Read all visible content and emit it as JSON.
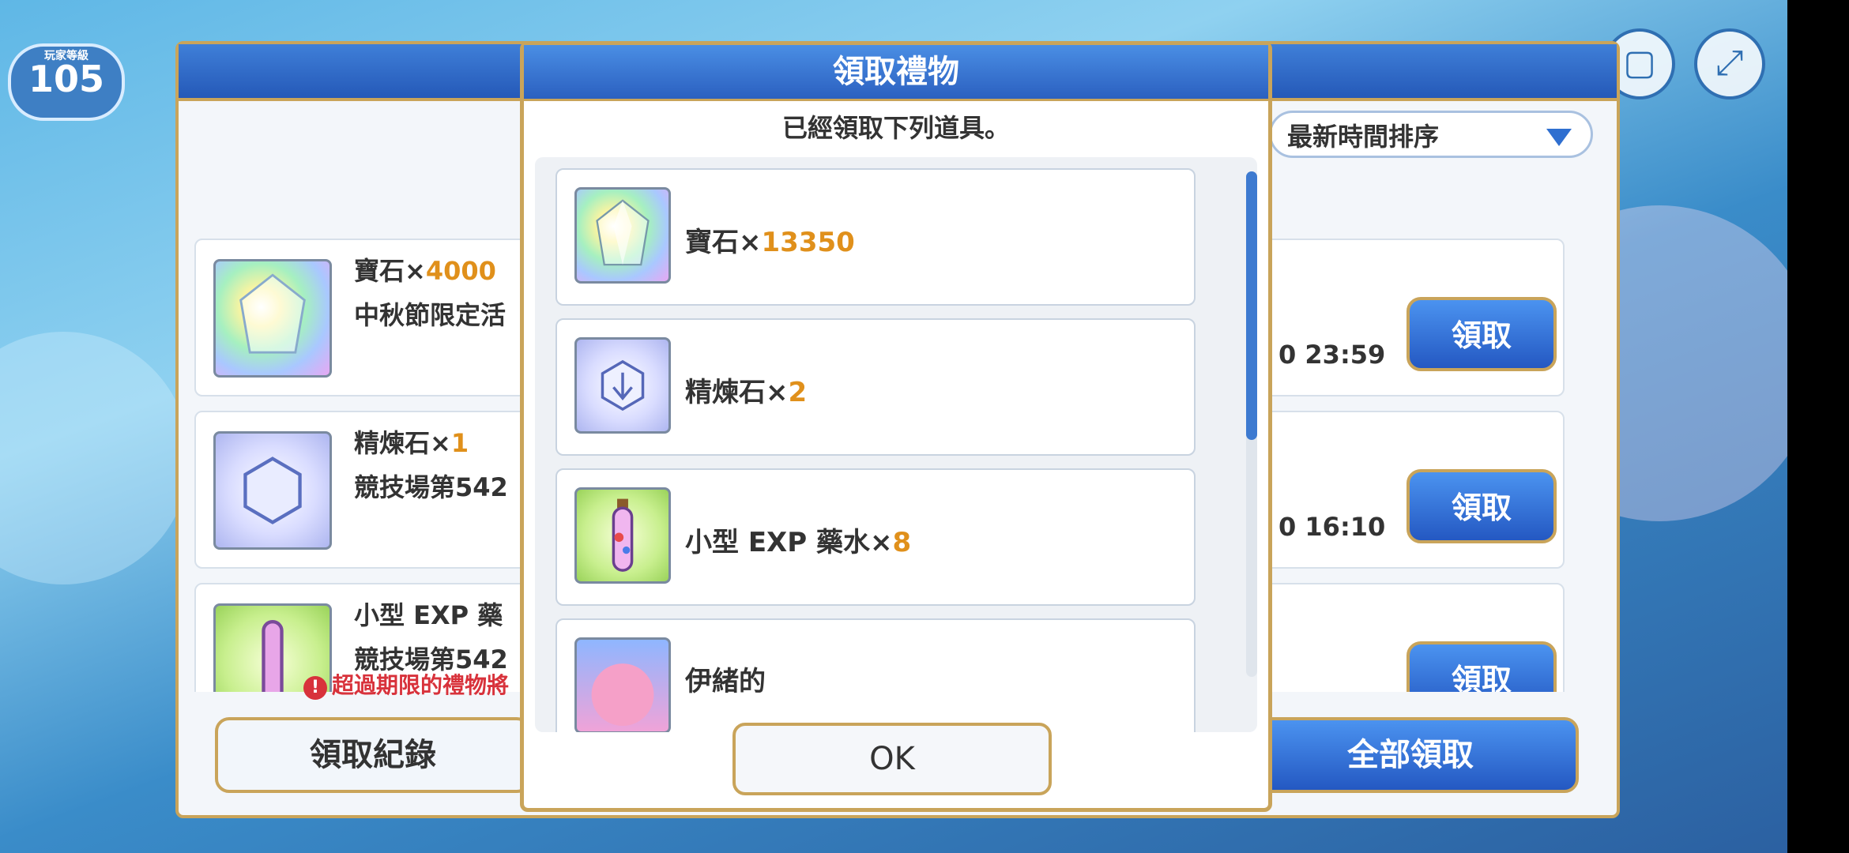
{
  "hud": {
    "level": "105",
    "level_caption": "玩家等級"
  },
  "panel": {
    "sort_label": "最新時間排序",
    "rows": [
      {
        "item": "寶石",
        "qty": "4000",
        "desc": "中秋節限定活",
        "time": "0 23:59",
        "button": "領取"
      },
      {
        "item": "精煉石",
        "qty": "1",
        "desc": "競技場第542",
        "time": "0 16:10",
        "button": "領取"
      },
      {
        "item": "小型 EXP 藥",
        "qty": "",
        "desc": "競技場第542",
        "time": "",
        "button": "領取"
      }
    ],
    "warning": "超過期限的禮物將",
    "log_button": "領取紀錄",
    "claim_all_button": "全部領取"
  },
  "modal": {
    "title": "領取禮物",
    "subtitle": "已經領取下列道具。",
    "times": "×",
    "items": [
      {
        "name": "寶石",
        "qty": "13350",
        "icon": "gem-icon"
      },
      {
        "name": "精煉石",
        "qty": "2",
        "icon": "refine-stone-icon"
      },
      {
        "name": "小型 EXP 藥水",
        "qty": "8",
        "icon": "exp-potion-icon"
      },
      {
        "name": "伊緒的",
        "qty": "",
        "icon": "character-card-icon"
      }
    ],
    "ok_button": "OK"
  },
  "colors": {
    "accent_blue": "#2b60c0",
    "gold_border": "#c9a45a",
    "quantity_orange": "#e0901b",
    "warning_red": "#d8323b"
  }
}
